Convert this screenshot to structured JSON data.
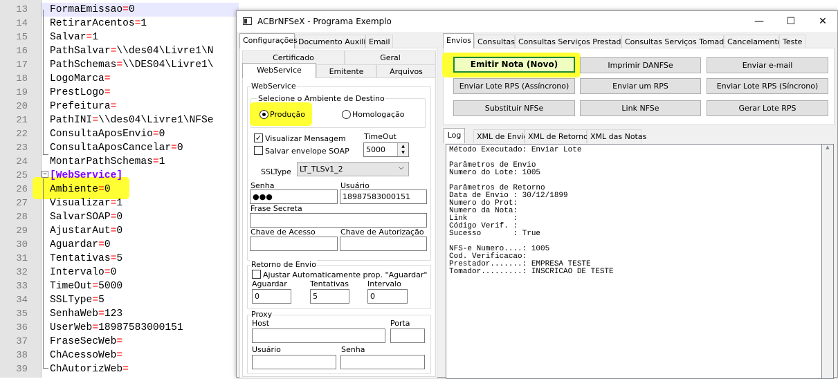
{
  "editor": {
    "lines": [
      {
        "num": "13",
        "key": "FormaEmissao",
        "val": "0"
      },
      {
        "num": "14",
        "key": "RetirarAcentos",
        "val": "1"
      },
      {
        "num": "15",
        "key": "Salvar",
        "val": "1"
      },
      {
        "num": "16",
        "key": "PathSalvar",
        "val": "\\\\des04\\Livre1\\N"
      },
      {
        "num": "17",
        "key": "PathSchemas",
        "val": "\\\\DES04\\Livre1\\"
      },
      {
        "num": "18",
        "key": "LogoMarca",
        "val": ""
      },
      {
        "num": "19",
        "key": "PrestLogo",
        "val": ""
      },
      {
        "num": "20",
        "key": "Prefeitura",
        "val": ""
      },
      {
        "num": "21",
        "key": "PathINI",
        "val": "\\\\des04\\Livre1\\NFSe"
      },
      {
        "num": "22",
        "key": "ConsultaAposEnvio",
        "val": "0"
      },
      {
        "num": "23",
        "key": "ConsultaAposCancelar",
        "val": "0"
      },
      {
        "num": "24",
        "key": "MontarPathSchemas",
        "val": "1"
      },
      {
        "num": "25",
        "section": "[WebService]"
      },
      {
        "num": "26",
        "key": "Ambiente",
        "val": "0"
      },
      {
        "num": "27",
        "key": "Visualizar",
        "val": "1"
      },
      {
        "num": "28",
        "key": "SalvarSOAP",
        "val": "0"
      },
      {
        "num": "29",
        "key": "AjustarAut",
        "val": "0"
      },
      {
        "num": "30",
        "key": "Aguardar",
        "val": "0"
      },
      {
        "num": "31",
        "key": "Tentativas",
        "val": "5"
      },
      {
        "num": "32",
        "key": "Intervalo",
        "val": "0"
      },
      {
        "num": "33",
        "key": "TimeOut",
        "val": "5000"
      },
      {
        "num": "34",
        "key": "SSLType",
        "val": "5"
      },
      {
        "num": "35",
        "key": "SenhaWeb",
        "val": "123"
      },
      {
        "num": "36",
        "key": "UserWeb",
        "val": "18987583000151"
      },
      {
        "num": "37",
        "key": "FraseSecWeb",
        "val": ""
      },
      {
        "num": "38",
        "key": "ChAcessoWeb",
        "val": ""
      },
      {
        "num": "39",
        "key": "ChAutorizWeb",
        "val": ""
      }
    ]
  },
  "window": {
    "title": "ACBrNFSeX - Programa Exemplo",
    "minimize": "—",
    "maximize": "☐",
    "close": "✕"
  },
  "left": {
    "tabs": [
      "Configurações",
      "Documento Auxiliar",
      "Email"
    ],
    "subtabs_row1": [
      "Certificado",
      "Geral"
    ],
    "subtabs_row2": [
      "WebService",
      "Emitente",
      "Arquivos"
    ],
    "webservice_group": "WebService",
    "ambiente_group": "Selecione o Ambiente de Destino",
    "producao": "Produção",
    "homologacao": "Homologação",
    "visualizar_msg": "Visualizar Mensagem",
    "salvar_envelope": "Salvar envelope SOAP",
    "timeout_label": "TimeOut",
    "timeout_value": "5000",
    "ssltype_label": "SSLType",
    "ssltype_value": "LT_TLSv1_2",
    "senha_label": "Senha",
    "senha_value": "●●●",
    "usuario_label": "Usuário",
    "usuario_value": "18987583000151",
    "frase_label": "Frase Secreta",
    "chave_acesso_label": "Chave de Acesso",
    "chave_autorizacao_label": "Chave de Autorização",
    "retorno_group": "Retorno de Envio",
    "ajustar_label": "Ajustar Automaticamente prop. \"Aguardar\"",
    "aguardar_label": "Aguardar",
    "aguardar_value": "0",
    "tentativas_label": "Tentativas",
    "tentativas_value": "5",
    "intervalo_label": "Intervalo",
    "intervalo_value": "0",
    "proxy_group": "Proxy",
    "host_label": "Host",
    "porta_label": "Porta",
    "proxy_usuario_label": "Usuário",
    "proxy_senha_label": "Senha"
  },
  "right": {
    "tabs": [
      "Envios",
      "Consultas",
      "Consultas Serviços Prestados",
      "Consultas Serviços Tomados",
      "Cancelamento",
      "Teste"
    ],
    "buttons": {
      "emitir": "Emitir Nota (Novo)",
      "imprimir": "Imprimir DANFSe",
      "email": "Enviar e-mail",
      "lote_assinc": "Enviar Lote RPS (Assíncrono)",
      "enviar_um": "Enviar um RPS",
      "lote_sinc": "Enviar Lote RPS (Síncrono)",
      "substituir": "Substituir NFSe",
      "link": "Link NFSe",
      "gerar_lote": "Gerar Lote RPS"
    },
    "log_tabs": [
      "Log",
      "XML de Envio",
      "XML de Retorno",
      "XML das Notas"
    ],
    "log_text": "Método Executado: Enviar Lote\n\nParâmetros de Envio\nNumero do Lote: 1005\n\nParâmetros de Retorno\nData de Envio : 30/12/1899\nNumero do Prot:\nNumero da Nota:\nLink          :\nCódigo Verif. :\nSucesso       : True\n\nNFS-e Numero....: 1005\nCod. Verificacao:\nPrestador.......: EMPRESA TESTE\nTomador.........: INSCRICAO DE TESTE"
  },
  "colors": {
    "highlight": "#ffff33",
    "equals": "#ff0000",
    "section": "#8000ff",
    "default_button_border": "#0078d7"
  }
}
